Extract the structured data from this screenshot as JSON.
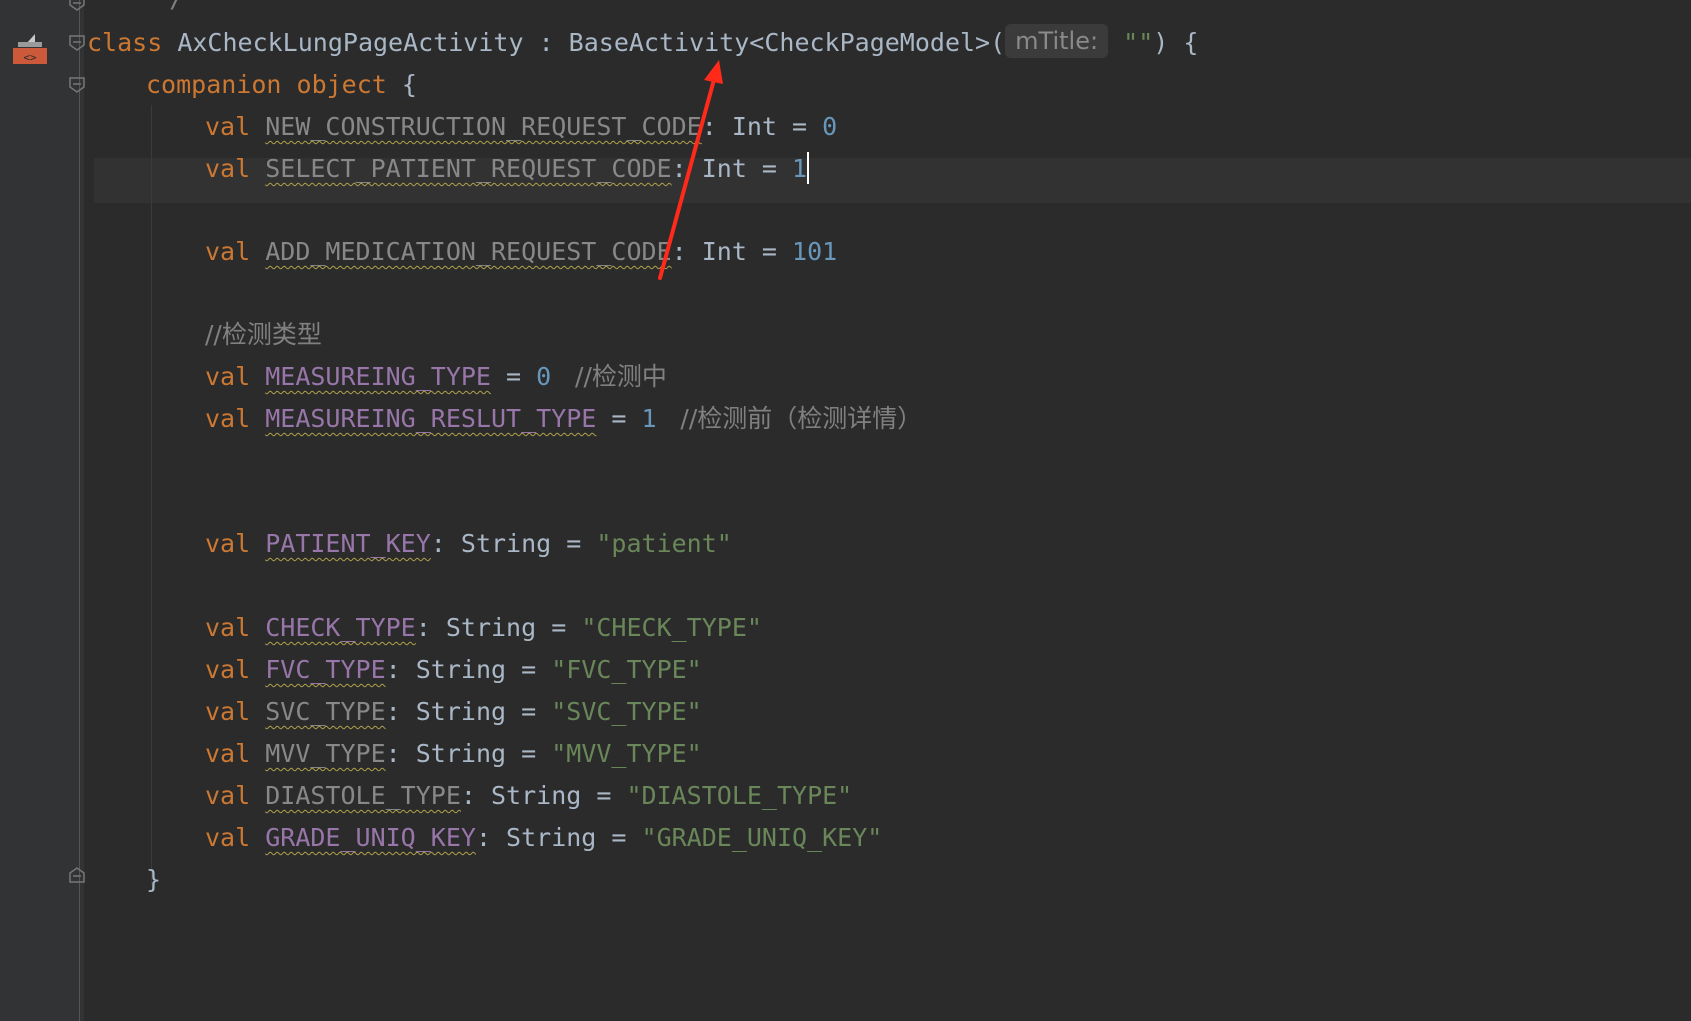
{
  "gutter": {
    "marker_icon": "android-layout-marker-icon",
    "marker_color": "#cc5a3a"
  },
  "code": {
    "top_fragment": "*/",
    "class_line": {
      "kw": "class",
      "name": "AxCheckLungPageActivity",
      "colon": " : ",
      "parent": "BaseActivity<CheckPageModel>(",
      "hint": "mTitle:",
      "arg": "\"\"",
      "tail": ") {"
    },
    "companion": {
      "kw": "companion object",
      "brace": " {"
    },
    "lines": [
      {
        "kw": "val",
        "name": "NEW_CONSTRUCTION_REQUEST_CODE",
        "type": ": Int = ",
        "value": "0"
      },
      {
        "kw": "val",
        "name": "SELECT_PATIENT_REQUEST_CODE",
        "type": ": Int = ",
        "value": "1"
      },
      {
        "kw": "val",
        "name": "ADD_MEDICATION_REQUEST_CODE",
        "type": ": Int = ",
        "value": "101"
      },
      {
        "comment": "//检测类型"
      },
      {
        "kw": "val",
        "name": "MEASUREING_TYPE",
        "type": " = ",
        "value": "0",
        "comment": "   //检测中"
      },
      {
        "kw": "val",
        "name": "MEASUREING_RESLUT_TYPE",
        "type": " = ",
        "value": "1",
        "comment": "   //检测前（检测详情）"
      },
      {
        "kw": "val",
        "name": "PATIENT_KEY",
        "type": ": String = ",
        "value": "\"patient\""
      },
      {
        "kw": "val",
        "name": "CHECK_TYPE",
        "type": ": String = ",
        "value": "\"CHECK_TYPE\""
      },
      {
        "kw": "val",
        "name": "FVC_TYPE",
        "type": ": String = ",
        "value": "\"FVC_TYPE\""
      },
      {
        "kw": "val",
        "name": "SVC_TYPE",
        "type": ": String = ",
        "value": "\"SVC_TYPE\""
      },
      {
        "kw": "val",
        "name": "MVV_TYPE",
        "type": ": String = ",
        "value": "\"MVV_TYPE\""
      },
      {
        "kw": "val",
        "name": "DIASTOLE_TYPE",
        "type": ": String = ",
        "value": "\"DIASTOLE_TYPE\""
      },
      {
        "kw": "val",
        "name": "GRADE_UNIQ_KEY",
        "type": ": String = ",
        "value": "\"GRADE_UNIQ_KEY\""
      }
    ],
    "close_brace": "}"
  },
  "annotation": {
    "arrow_color": "#ff2a1a"
  }
}
